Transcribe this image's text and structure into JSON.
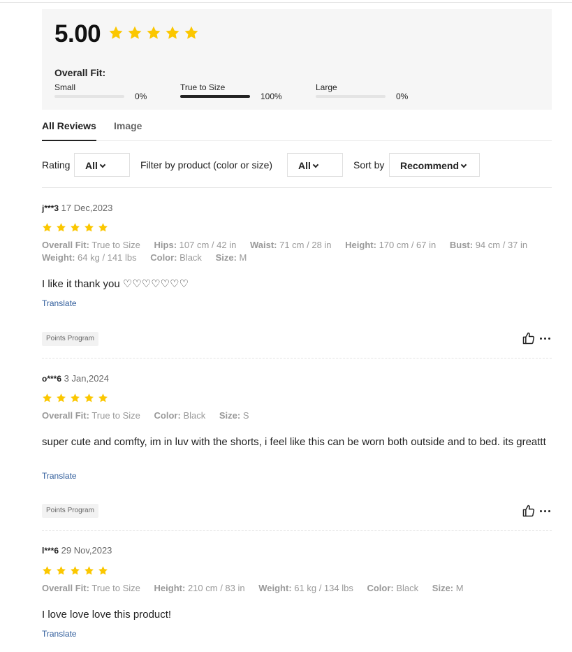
{
  "summary": {
    "score": "5.00",
    "star_color": "#fbc700",
    "fit_title": "Overall Fit:",
    "fit": [
      {
        "label": "Small",
        "pct": "0%",
        "value": 0
      },
      {
        "label": "True to Size",
        "pct": "100%",
        "value": 100
      },
      {
        "label": "Large",
        "pct": "0%",
        "value": 0
      }
    ]
  },
  "tabs": [
    {
      "label": "All Reviews",
      "active": true
    },
    {
      "label": "Image",
      "active": false
    }
  ],
  "filters": {
    "rating_label": "Rating",
    "rating_value": "All",
    "product_label": "Filter by product  (color or size)",
    "product_value": "All",
    "sort_label": "Sort by",
    "sort_value": "Recommend"
  },
  "reviews": [
    {
      "user": "j***3",
      "date": "17 Dec,2023",
      "rating": 5,
      "attributes": [
        {
          "key": "Overall Fit:",
          "value": "True to Size"
        },
        {
          "key": "Hips:",
          "value": "107 cm / 42 in"
        },
        {
          "key": "Waist:",
          "value": "71 cm / 28 in"
        },
        {
          "key": "Height:",
          "value": "170 cm / 67 in"
        },
        {
          "key": "Bust:",
          "value": "94 cm / 37 in"
        },
        {
          "key": "Weight:",
          "value": "64 kg / 141 lbs"
        },
        {
          "key": "Color:",
          "value": "Black"
        },
        {
          "key": "Size:",
          "value": "M"
        }
      ],
      "content": "I like it thank you ♡♡♡♡♡♡♡",
      "translate": "Translate",
      "badge": "Points Program"
    },
    {
      "user": "o***6",
      "date": "3 Jan,2024",
      "rating": 5,
      "attributes": [
        {
          "key": "Overall Fit:",
          "value": "True to Size"
        },
        {
          "key": "Color:",
          "value": "Black"
        },
        {
          "key": "Size:",
          "value": "S"
        }
      ],
      "content": "super cute and comfty, im in luv with the shorts, i feel like this can be worn both outside and to bed. its greattt",
      "translate": "Translate",
      "badge": "Points Program"
    },
    {
      "user": "l***6",
      "date": "29 Nov,2023",
      "rating": 5,
      "attributes": [
        {
          "key": "Overall Fit:",
          "value": "True to Size"
        },
        {
          "key": "Height:",
          "value": "210 cm / 83 in"
        },
        {
          "key": "Weight:",
          "value": "61 kg / 134 lbs"
        },
        {
          "key": "Color:",
          "value": "Black"
        },
        {
          "key": "Size:",
          "value": "M"
        }
      ],
      "content": "I love love love this product!",
      "translate": "Translate"
    }
  ]
}
